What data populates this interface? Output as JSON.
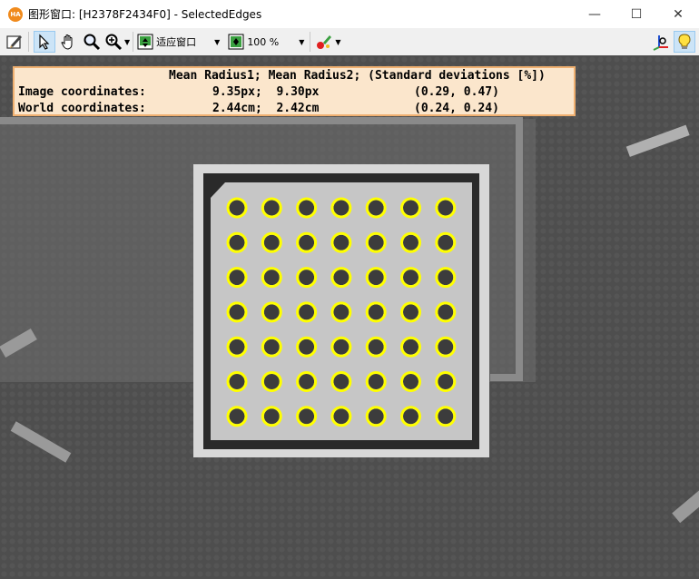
{
  "window": {
    "logo_text": "HA",
    "title": "图形窗口: [H2378F2434F0] - SelectedEdges",
    "minimize_glyph": "—",
    "maximize_glyph": "☐",
    "close_glyph": "✕"
  },
  "toolbar": {
    "tools": [
      {
        "name": "edit-icon"
      },
      {
        "name": "pointer-icon",
        "active": true
      },
      {
        "name": "hand-icon"
      },
      {
        "name": "magnifier-icon"
      },
      {
        "name": "zoom-in-icon"
      }
    ],
    "fit_label": "适应窗口",
    "zoom_label": "100 %",
    "paint_icon": "paint-icon",
    "right_tools": [
      "coordinate-icon",
      "lightbulb-icon"
    ]
  },
  "info": {
    "header": "Mean Radius1; Mean Radius2; (Standard deviations [%])",
    "row1_label": "Image coordinates:",
    "row1_values": "9.35px;  9.30px",
    "row1_std": "(0.29, 0.47)",
    "row2_label": "World coordinates:",
    "row2_values": "2.44cm;  2.42cm",
    "row2_std": "(0.24, 0.24)"
  },
  "calibration_plate": {
    "rows": 7,
    "cols": 7,
    "dot_color": "#3c3c3c",
    "edge_color": "#ffff00"
  },
  "colors": {
    "background": "#4d4d4d",
    "plate": "#c9c9c9",
    "info_bg": "#fbe6cc",
    "info_border": "#f0b070"
  }
}
